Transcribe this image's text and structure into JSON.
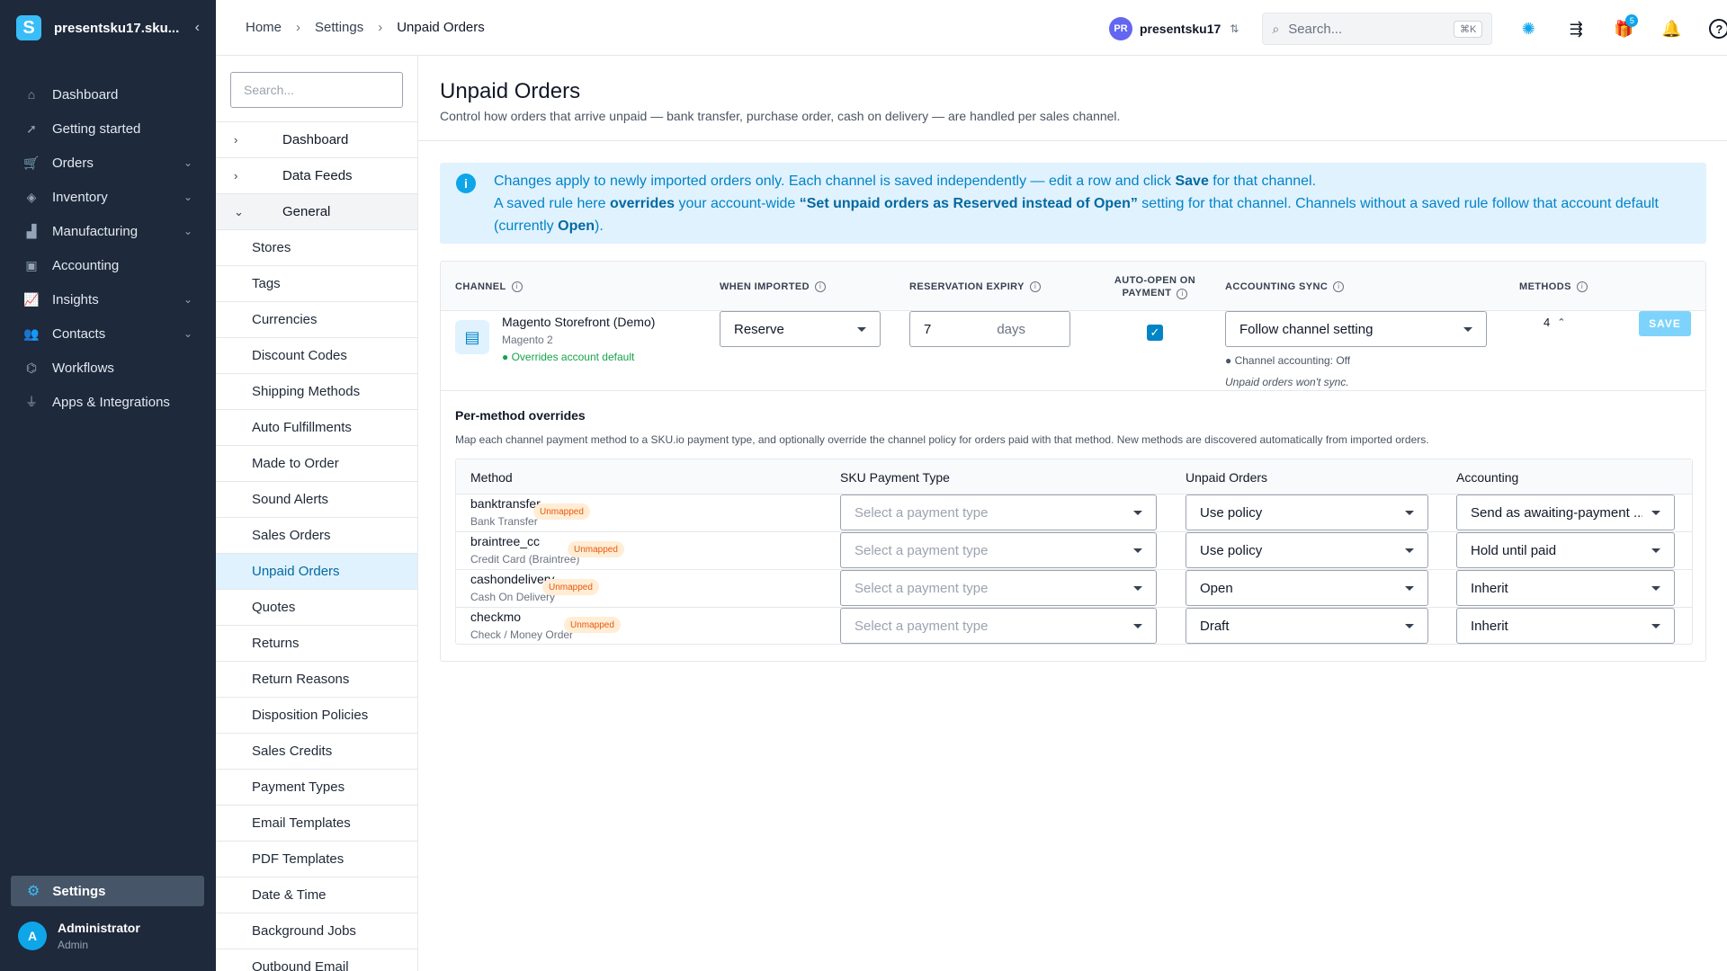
{
  "app": {
    "store_name": "presentsku17.sku...",
    "logo_letter": "S",
    "collapse_glyph": "‹"
  },
  "nav": {
    "items": [
      {
        "label": "Dashboard",
        "icon": "home-icon",
        "glyph": "⌂",
        "chevron": ""
      },
      {
        "label": "Getting started",
        "icon": "rocket-icon",
        "glyph": "➚",
        "chevron": ""
      },
      {
        "label": "Orders",
        "icon": "cart-icon",
        "glyph": "🛒",
        "chevron": "⌄"
      },
      {
        "label": "Inventory",
        "icon": "box-icon",
        "glyph": "◈",
        "chevron": "⌄"
      },
      {
        "label": "Manufacturing",
        "icon": "factory-icon",
        "glyph": "▟",
        "chevron": "⌄"
      },
      {
        "label": "Accounting",
        "icon": "book-icon",
        "glyph": "▣",
        "chevron": ""
      },
      {
        "label": "Insights",
        "icon": "chart-icon",
        "glyph": "📈",
        "chevron": "⌄"
      },
      {
        "label": "Contacts",
        "icon": "users-icon",
        "glyph": "👥",
        "chevron": "⌄"
      },
      {
        "label": "Workflows",
        "icon": "workflow-icon",
        "glyph": "⌬",
        "chevron": ""
      },
      {
        "label": "Apps & Integrations",
        "icon": "plug-icon",
        "glyph": "⏚",
        "chevron": ""
      }
    ],
    "settings_label": "Settings",
    "settings_glyph": "⚙",
    "user": {
      "initial": "A",
      "name": "Administrator",
      "role": "Admin"
    }
  },
  "header": {
    "breadcrumbs": [
      "Home",
      "Settings",
      "Unpaid Orders"
    ],
    "crumb_sep": "›",
    "org_initials": "PR",
    "org_name": "presentsku17",
    "org_sort_glyph": "⇅",
    "search_placeholder": "Search...",
    "search_shortcut": "⌘K",
    "gift_badge": "5",
    "icons": {
      "sparkle": "✺",
      "tasks": "⇶",
      "gift": "🎁",
      "bell": "🔔",
      "help": "?",
      "search": "⌕"
    }
  },
  "subnav": {
    "search_placeholder": "Search...",
    "groups": [
      {
        "label": "Dashboard",
        "glyph": "›"
      },
      {
        "label": "Data Feeds",
        "glyph": "›"
      },
      {
        "label": "General",
        "glyph": "⌄"
      }
    ],
    "items": [
      "Stores",
      "Tags",
      "Currencies",
      "Discount Codes",
      "Shipping Methods",
      "Auto Fulfillments",
      "Made to Order",
      "Sound Alerts",
      "Sales Orders",
      "Unpaid Orders",
      "Quotes",
      "Returns",
      "Return Reasons",
      "Disposition Policies",
      "Sales Credits",
      "Payment Types",
      "Email Templates",
      "PDF Templates",
      "Date & Time",
      "Background Jobs",
      "Outbound Email"
    ],
    "active_item": "Unpaid Orders"
  },
  "page": {
    "title": "Unpaid Orders",
    "subtitle": "Control how orders that arrive unpaid — bank transfer, purchase order, cash on delivery — are handled per sales channel.",
    "info": {
      "line1_pre": "Changes apply to newly imported orders only. Each channel is saved independently — edit a row and click ",
      "line1_bold": "Save",
      "line1_post": " for that channel.",
      "line2_pre": "A saved rule here ",
      "line2_bold1": "overrides",
      "line2_mid": " your account-wide ",
      "line2_bold2": "“Set unpaid orders as Reserved instead of Open”",
      "line2_post": " setting for that channel. Channels without a saved rule follow that account default (currently ",
      "line2_bold3": "Open",
      "line2_end": ")."
    }
  },
  "table": {
    "headers": {
      "channel": "CHANNEL",
      "when_imported": "WHEN IMPORTED",
      "reservation_expiry": "RESERVATION EXPIRY",
      "auto_open_1": "AUTO-OPEN ON",
      "auto_open_2": "PAYMENT",
      "accounting_sync": "ACCOUNTING SYNC",
      "methods": "METHODS"
    },
    "channel": {
      "name": "Magento Storefront (Demo)",
      "type": "Magento 2",
      "override_note": "● Overrides account default",
      "when_imported": "Reserve",
      "expiry_value": "7",
      "expiry_unit": "days",
      "auto_open_checked": true,
      "checkmark": "✓",
      "accounting_sync": "Follow channel setting",
      "accounting_note": "● Channel accounting: Off",
      "accounting_note2": "Unpaid orders won't sync.",
      "methods_count": "4",
      "methods_toggle": "⌃",
      "save_label": "SAVE"
    }
  },
  "per_method": {
    "title": "Per-method overrides",
    "description": "Map each channel payment method to a SKU.io payment type, and optionally override the channel policy for orders paid with that method. New methods are discovered automatically from imported orders.",
    "headers": [
      "Method",
      "SKU Payment Type",
      "Unpaid Orders",
      "Accounting"
    ],
    "rows": [
      {
        "code": "banktransfer",
        "label": "Bank Transfer",
        "badge": "Unmapped",
        "payment_type": "Select a payment type",
        "unpaid": "Use policy",
        "accounting": "Send as awaiting-payment ..."
      },
      {
        "code": "braintree_cc",
        "label": "Credit Card (Braintree)",
        "badge": "Unmapped",
        "payment_type": "Select a payment type",
        "unpaid": "Use policy",
        "accounting": "Hold until paid"
      },
      {
        "code": "cashondelivery",
        "label": "Cash On Delivery",
        "badge": "Unmapped",
        "payment_type": "Select a payment type",
        "unpaid": "Open",
        "accounting": "Inherit"
      },
      {
        "code": "checkmo",
        "label": "Check / Money Order",
        "badge": "Unmapped",
        "payment_type": "Select a payment type",
        "unpaid": "Draft",
        "accounting": "Inherit"
      }
    ]
  },
  "colors": {
    "sidebar_bg": "#1e293b",
    "accent": "#0ea5e9",
    "info_bg": "#e0f2fe",
    "active_item_bg": "#e0f2fe",
    "unmapped_bg": "#ffedd5"
  }
}
